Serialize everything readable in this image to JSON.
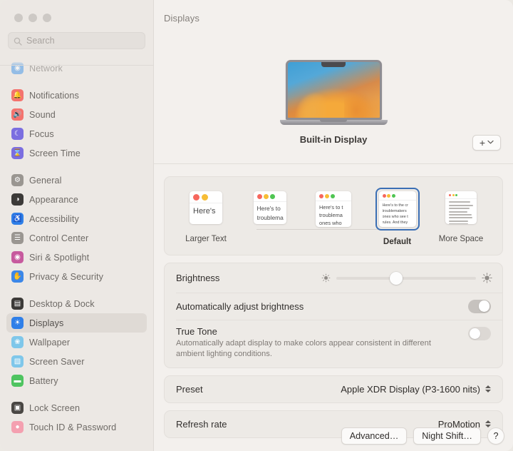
{
  "window": {
    "traffic_lights": [
      "close",
      "minimize",
      "zoom"
    ]
  },
  "search": {
    "placeholder": "Search",
    "icon": "search-icon"
  },
  "sidebar": {
    "groups": [
      {
        "items": [
          {
            "label": "Network",
            "icon": "network-icon",
            "color": "#3e93e8",
            "glyph": "◉",
            "clipped": true
          }
        ]
      },
      {
        "items": [
          {
            "label": "Notifications",
            "icon": "bell-icon",
            "color": "#f4736e",
            "glyph": "🔔"
          },
          {
            "label": "Sound",
            "icon": "speaker-icon",
            "color": "#f4736e",
            "glyph": "🔊"
          },
          {
            "label": "Focus",
            "icon": "moon-icon",
            "color": "#7b6ee0",
            "glyph": "☾"
          },
          {
            "label": "Screen Time",
            "icon": "hourglass-icon",
            "color": "#7b6ee0",
            "glyph": "⌛"
          }
        ]
      },
      {
        "items": [
          {
            "label": "General",
            "icon": "gear-icon",
            "color": "#9a9691",
            "glyph": "⚙"
          },
          {
            "label": "Appearance",
            "icon": "appearance-icon",
            "color": "#3c3a38",
            "glyph": "◑"
          },
          {
            "label": "Accessibility",
            "icon": "accessibility-icon",
            "color": "#2f7fe8",
            "glyph": "♿"
          },
          {
            "label": "Control Center",
            "icon": "control-center-icon",
            "color": "#9a9691",
            "glyph": "☰"
          },
          {
            "label": "Siri & Spotlight",
            "icon": "siri-icon",
            "color": "#c75a9e",
            "glyph": "◉"
          },
          {
            "label": "Privacy & Security",
            "icon": "hand-icon",
            "color": "#3c87e8",
            "glyph": "✋"
          }
        ]
      },
      {
        "items": [
          {
            "label": "Desktop & Dock",
            "icon": "desktop-dock-icon",
            "color": "#3c3a38",
            "glyph": "▤"
          },
          {
            "label": "Displays",
            "icon": "displays-icon",
            "color": "#2f7fe8",
            "glyph": "☀",
            "selected": true
          },
          {
            "label": "Wallpaper",
            "icon": "wallpaper-icon",
            "color": "#7fc7ea",
            "glyph": "❀"
          },
          {
            "label": "Screen Saver",
            "icon": "screen-saver-icon",
            "color": "#7fc7ea",
            "glyph": "▧"
          },
          {
            "label": "Battery",
            "icon": "battery-icon",
            "color": "#4fc460",
            "glyph": "▬"
          }
        ]
      },
      {
        "items": [
          {
            "label": "Lock Screen",
            "icon": "lock-screen-icon",
            "color": "#4a4744",
            "glyph": "▣"
          },
          {
            "label": "Touch ID & Password",
            "icon": "touch-id-icon",
            "color": "#f4a0b0",
            "glyph": "●"
          }
        ]
      }
    ]
  },
  "header": {
    "title": "Displays"
  },
  "hero": {
    "display_name": "Built-in Display",
    "add_button": {
      "plus": "+",
      "chevron": "⌄",
      "name": "add-display-button"
    }
  },
  "resolutions": {
    "options": [
      {
        "label": "Larger Text",
        "selected": false,
        "thumb_w": 46,
        "thumb_h": 46,
        "dot_size": 9,
        "dot_gap": 7,
        "dots": 2,
        "font_size": 11,
        "lines": [
          "Here's"
        ],
        "mode": "text"
      },
      {
        "label": "",
        "selected": false,
        "thumb_w": 46,
        "thumb_h": 46,
        "dot_size": 7,
        "dot_gap": 5,
        "dots": 3,
        "font_size": 8.4,
        "lines": [
          "Here's to",
          "troublema"
        ],
        "mode": "text"
      },
      {
        "label": "",
        "selected": false,
        "thumb_w": 50,
        "thumb_h": 50,
        "dot_size": 6,
        "dot_gap": 4,
        "dots": 3,
        "font_size": 7.4,
        "lines": [
          "Here's to t",
          "troublema",
          "ones who"
        ],
        "mode": "text"
      },
      {
        "label": "Default",
        "selected": true,
        "thumb_w": 52,
        "thumb_h": 50,
        "dot_size": 5,
        "dot_gap": 4,
        "dots": 3,
        "font_size": 5.4,
        "lines": [
          "Here's to the cr",
          "troublemakers",
          "ones who see t",
          "rules. And they"
        ],
        "mode": "text"
      },
      {
        "label": "More Space",
        "selected": false,
        "thumb_w": 44,
        "thumb_h": 46,
        "dot_size": 3.4,
        "dot_gap": 2.6,
        "dots": 3,
        "micro_lines": 8,
        "mode": "micro"
      }
    ]
  },
  "brightness": {
    "label": "Brightness",
    "value_percent": 43,
    "low_icon": "sun-low-icon",
    "high_icon": "sun-high-icon"
  },
  "auto_brightness": {
    "label": "Automatically adjust brightness",
    "enabled": true
  },
  "true_tone": {
    "label": "True Tone",
    "description": "Automatically adapt display to make colors appear consistent in different ambient lighting conditions.",
    "enabled": false
  },
  "preset": {
    "label": "Preset",
    "value": "Apple XDR Display (P3-1600 nits)"
  },
  "refresh_rate": {
    "label": "Refresh rate",
    "value": "ProMotion"
  },
  "footer": {
    "advanced": "Advanced…",
    "night_shift": "Night Shift…",
    "help": "?"
  },
  "colors": {
    "accent": "#3b6fb5",
    "window_bg": "#f3f0ed",
    "sidebar_bg": "#ece8e4",
    "card_bg": "#edeae6"
  }
}
